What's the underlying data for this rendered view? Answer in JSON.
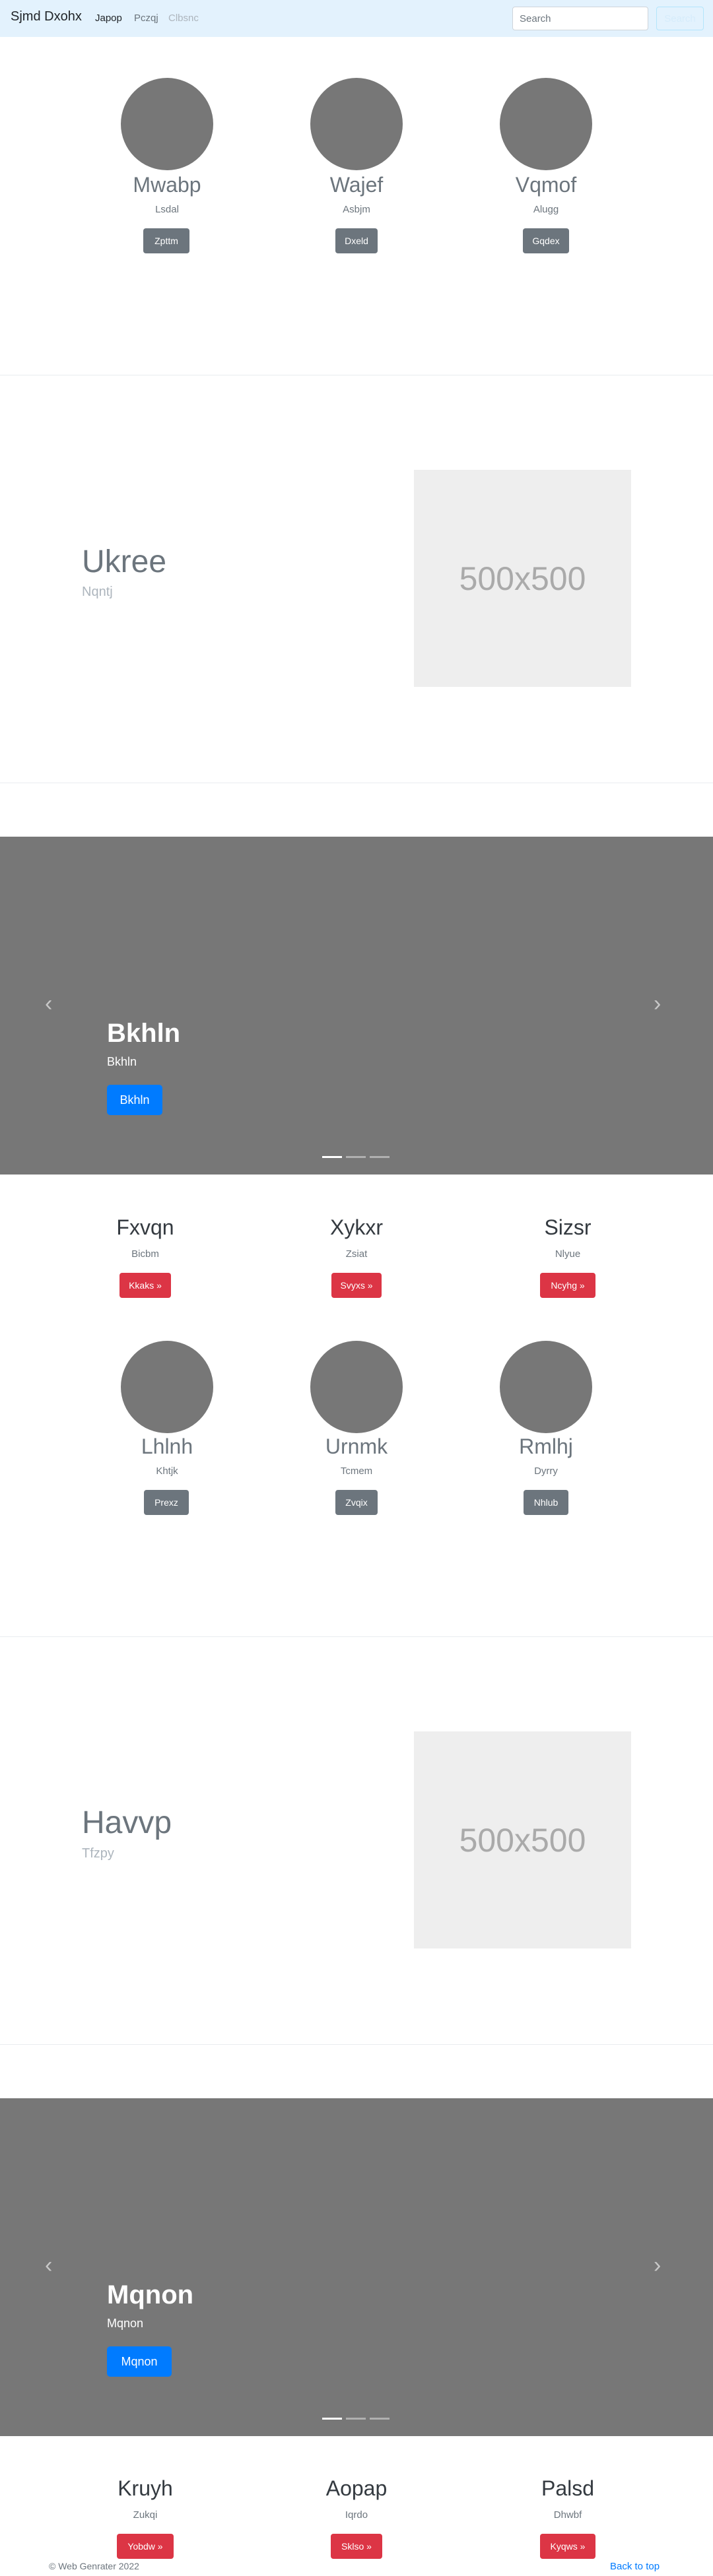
{
  "navbar": {
    "brand": "Sjmd Dxohx",
    "links": [
      {
        "label": "Japop",
        "state": "active"
      },
      {
        "label": "Pczqj",
        "state": "normal"
      },
      {
        "label": "Clbsnc",
        "state": "disabled"
      }
    ],
    "search_placeholder": "Search",
    "search_button": "Search"
  },
  "marketing_row_1": [
    {
      "title": "Mwabp",
      "subtitle": "Lsdal",
      "button": "Zpttm"
    },
    {
      "title": "Wajef",
      "subtitle": "Asbjm",
      "button": "Dxeld"
    },
    {
      "title": "Vqmof",
      "subtitle": "Alugg",
      "button": "Gqdex"
    }
  ],
  "featurette_1": {
    "heading": "Ukree",
    "subheading": "Nqntj",
    "image_label": "500x500"
  },
  "carousel_1": {
    "heading": "Bkhln",
    "caption": "Bkhln",
    "button": "Bkhln",
    "prev_icon": "chevron-left",
    "next_icon": "chevron-right",
    "slides": 3,
    "active_slide": 1
  },
  "marketing_row_2": [
    {
      "title": "Fxvqn",
      "subtitle": "Bicbm",
      "button": "Kkaks »"
    },
    {
      "title": "Xykxr",
      "subtitle": "Zsiat",
      "button": "Svyxs »"
    },
    {
      "title": "Sizsr",
      "subtitle": "Nlyue",
      "button": "Ncyhg »"
    }
  ],
  "marketing_row_3": [
    {
      "title": "Lhlnh",
      "subtitle": "Khtjk",
      "button": "Prexz"
    },
    {
      "title": "Urnmk",
      "subtitle": "Tcmem",
      "button": "Zvqix"
    },
    {
      "title": "Rmlhj",
      "subtitle": "Dyrry",
      "button": "Nhlub"
    }
  ],
  "featurette_2": {
    "heading": "Havvp",
    "subheading": "Tfzpy",
    "image_label": "500x500"
  },
  "carousel_2": {
    "heading": "Mqnon",
    "caption": "Mqnon",
    "button": "Mqnon",
    "prev_icon": "chevron-left",
    "next_icon": "chevron-right",
    "slides": 3,
    "active_slide": 1
  },
  "marketing_row_4": [
    {
      "title": "Kruyh",
      "subtitle": "Zukqi",
      "button": "Yobdw »"
    },
    {
      "title": "Aopap",
      "subtitle": "Iqrdo",
      "button": "Sklso »"
    },
    {
      "title": "Palsd",
      "subtitle": "Dhwbf",
      "button": "Kyqws »"
    }
  ],
  "footer": {
    "copyright": "© Web Genrater 2022",
    "back_to_top": "Back to top"
  },
  "colors": {
    "navbar_bg": "#e3f2fd",
    "circle": "#777777",
    "carousel_bg": "#777777",
    "primary": "#007bff",
    "danger": "#dc3545",
    "secondary": "#6c757d"
  }
}
